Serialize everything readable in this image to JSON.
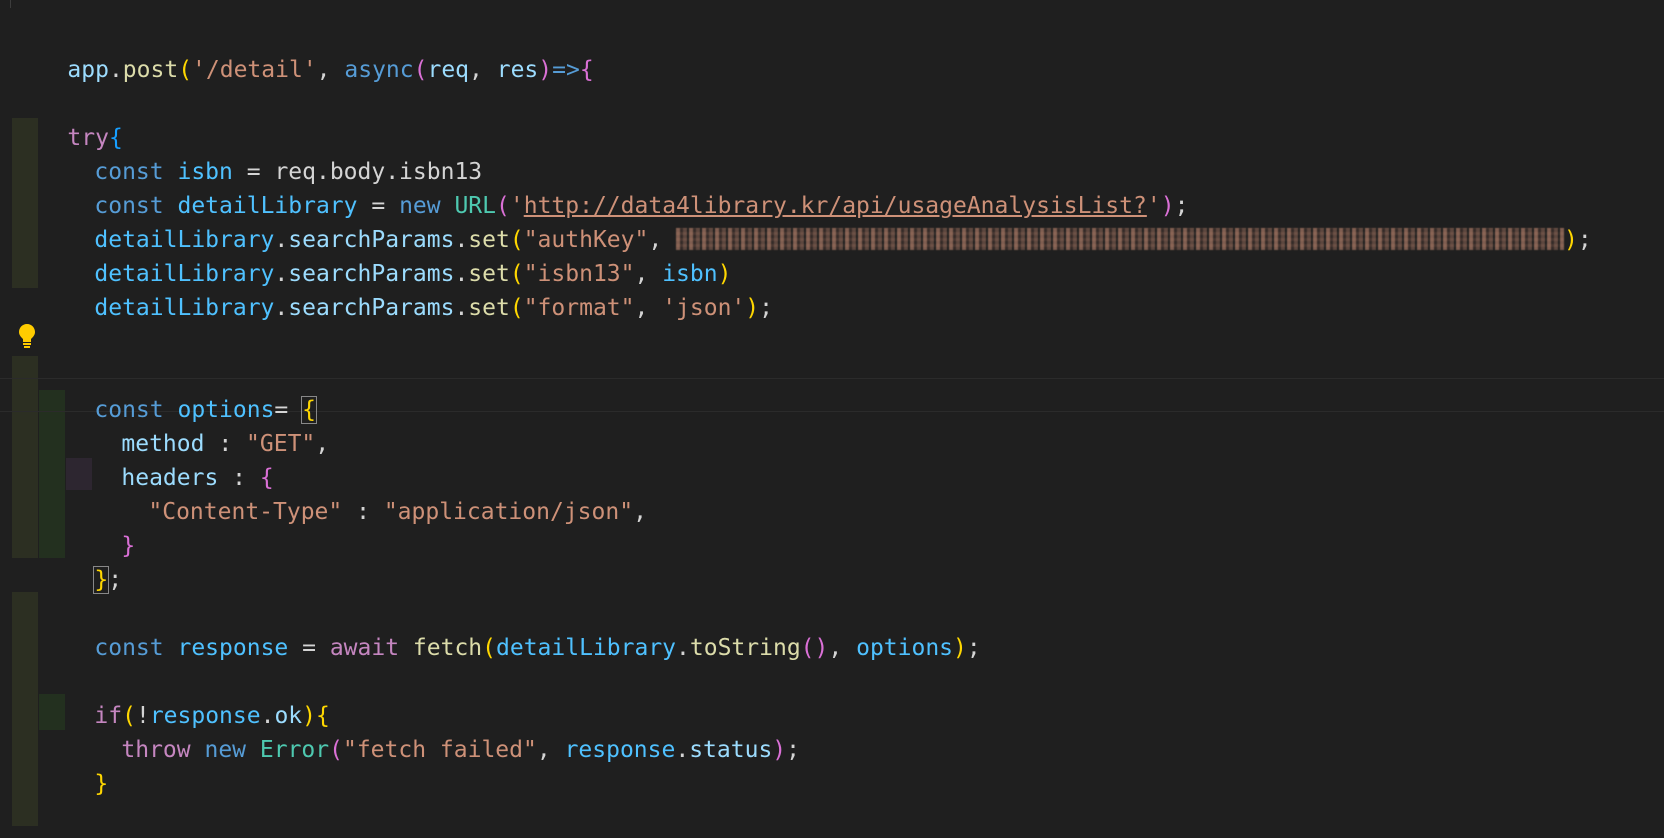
{
  "code": {
    "l1": {
      "obj": "app",
      "dot": ".",
      "method": "post",
      "open": "(",
      "route": "'/detail'",
      "comma": ", ",
      "async": "async",
      "popen": "(",
      "p1": "req",
      "pcomma": ", ",
      "p2": "res",
      "pclose": ")",
      "arrow": "=>",
      "brace": "{"
    },
    "l3": {
      "try": "try",
      "brace": "{"
    },
    "l4": {
      "const": "const",
      "name": " isbn ",
      "eq": "= ",
      "expr": "req.body.isbn13"
    },
    "l5": {
      "const": "const",
      "name": " detailLibrary",
      "eq": " = ",
      "new": "new",
      "cls": " URL",
      "open": "(",
      "q1": "'",
      "url": "http://data4library.kr/api/usageAnalysisList?",
      "q2": "'",
      "close": ")",
      "semi": ";"
    },
    "l6": {
      "obj": "detailLibrary",
      "dot1": ".",
      "prop": "searchParams",
      "dot2": ".",
      "fn": "set",
      "open": "(",
      "key": "\"authKey\"",
      "comma": ", ",
      "close": ")",
      "semi": ";"
    },
    "l7": {
      "obj": "detailLibrary",
      "dot1": ".",
      "prop": "searchParams",
      "dot2": ".",
      "fn": "set",
      "open": "(",
      "key": "\"isbn13\"",
      "comma": ", ",
      "arg": "isbn",
      "close": ")"
    },
    "l8": {
      "obj": "detailLibrary",
      "dot1": ".",
      "prop": "searchParams",
      "dot2": ".",
      "fn": "set",
      "open": "(",
      "key": "\"format\"",
      "comma": ", ",
      "arg": "'json'",
      "close": ")",
      "semi": ";"
    },
    "l10": {
      "const": "const",
      "name": " options",
      "eq": "= ",
      "brace": "{"
    },
    "l11": {
      "key": "method",
      "colon": " : ",
      "val": "\"GET\"",
      "comma": ","
    },
    "l12": {
      "key": "headers",
      "colon": " : ",
      "brace": "{"
    },
    "l13": {
      "key": "\"Content-Type\"",
      "colon": " : ",
      "val": "\"application/json\"",
      "comma": ","
    },
    "l14": {
      "brace": "}"
    },
    "l15": {
      "brace": "}",
      "semi": ";"
    },
    "l17": {
      "const": "const",
      "name": " response",
      "eq": " = ",
      "await": "await",
      "fn": " fetch",
      "open": "(",
      "obj": "detailLibrary",
      "dot": ".",
      "method": "toString",
      "popen": "(",
      "pclose": ")",
      "comma": ", ",
      "arg": "options",
      "close": ")",
      "semi": ";"
    },
    "l19": {
      "if": "if",
      "open": "(",
      "not": "!",
      "obj": "response",
      "dot": ".",
      "prop": "ok",
      "close": ")",
      "brace": "{"
    },
    "l20": {
      "throw": "throw",
      "new": " new",
      "cls": " Error",
      "open": "(",
      "msg": "\"fetch failed\"",
      "comma": ", ",
      "obj": "response",
      "dot": ".",
      "prop": "status",
      "close": ")",
      "semi": ";"
    },
    "l21": {
      "brace": "}"
    }
  }
}
